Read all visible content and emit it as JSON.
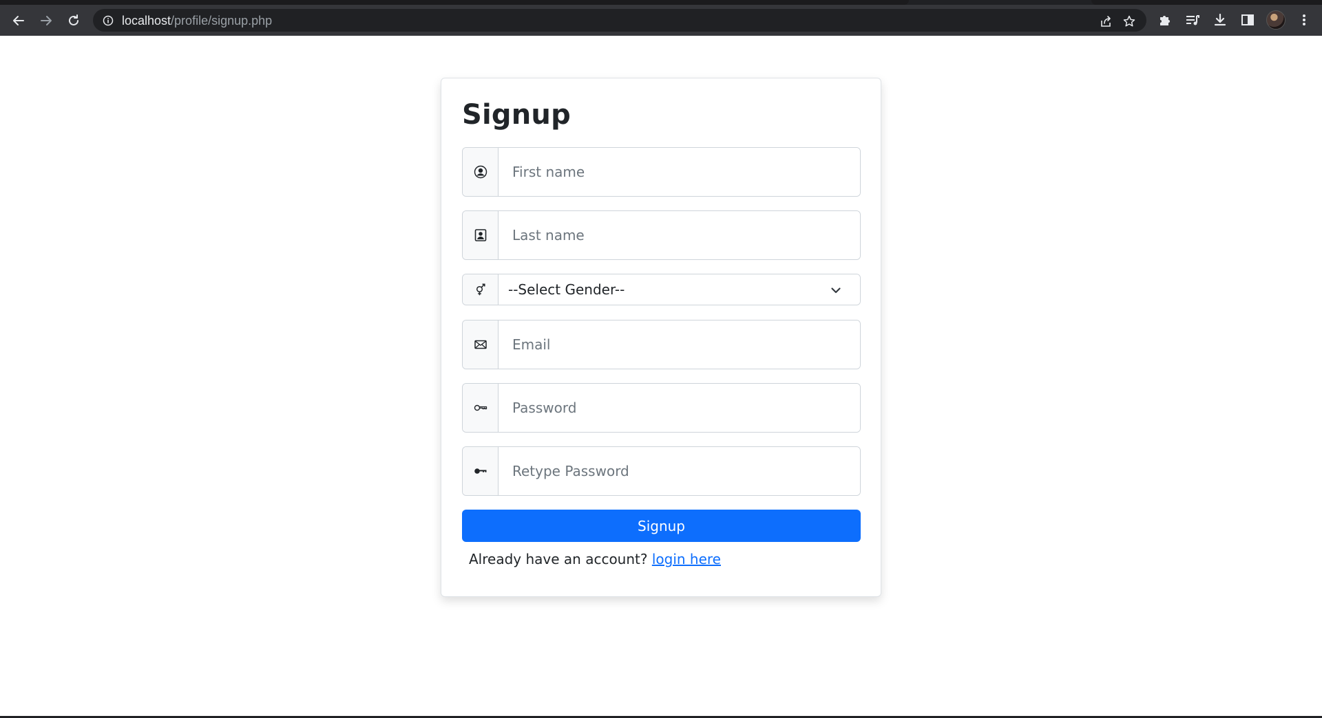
{
  "browser": {
    "url_host": "localhost",
    "url_path": "/profile/signup.php"
  },
  "icons": {
    "back": "back-arrow-icon",
    "forward": "forward-arrow-icon",
    "reload": "reload-icon",
    "site_info": "info-icon",
    "share": "share-icon",
    "bookmark": "star-icon",
    "extensions": "puzzle-icon",
    "media": "media-queue-icon",
    "download": "download-icon",
    "side_panel": "side-panel-icon",
    "menu": "kebab-menu-icon"
  },
  "form": {
    "title": "Signup",
    "first_name": {
      "placeholder": "First name",
      "icon": "person-circle-icon"
    },
    "last_name": {
      "placeholder": "Last name",
      "icon": "person-badge-icon"
    },
    "gender": {
      "selected": "--Select Gender--",
      "icon": "gender-icon"
    },
    "email": {
      "placeholder": "Email",
      "icon": "envelope-icon"
    },
    "password": {
      "placeholder": "Password",
      "icon": "key-outline-icon"
    },
    "retype_password": {
      "placeholder": "Retype Password",
      "icon": "key-fill-icon"
    },
    "submit_label": "Signup",
    "login_prompt": "Already have an account?",
    "login_link": "login here"
  },
  "colors": {
    "primary": "#0d6efd",
    "chrome": "#35363a",
    "omnibox": "#202124"
  }
}
